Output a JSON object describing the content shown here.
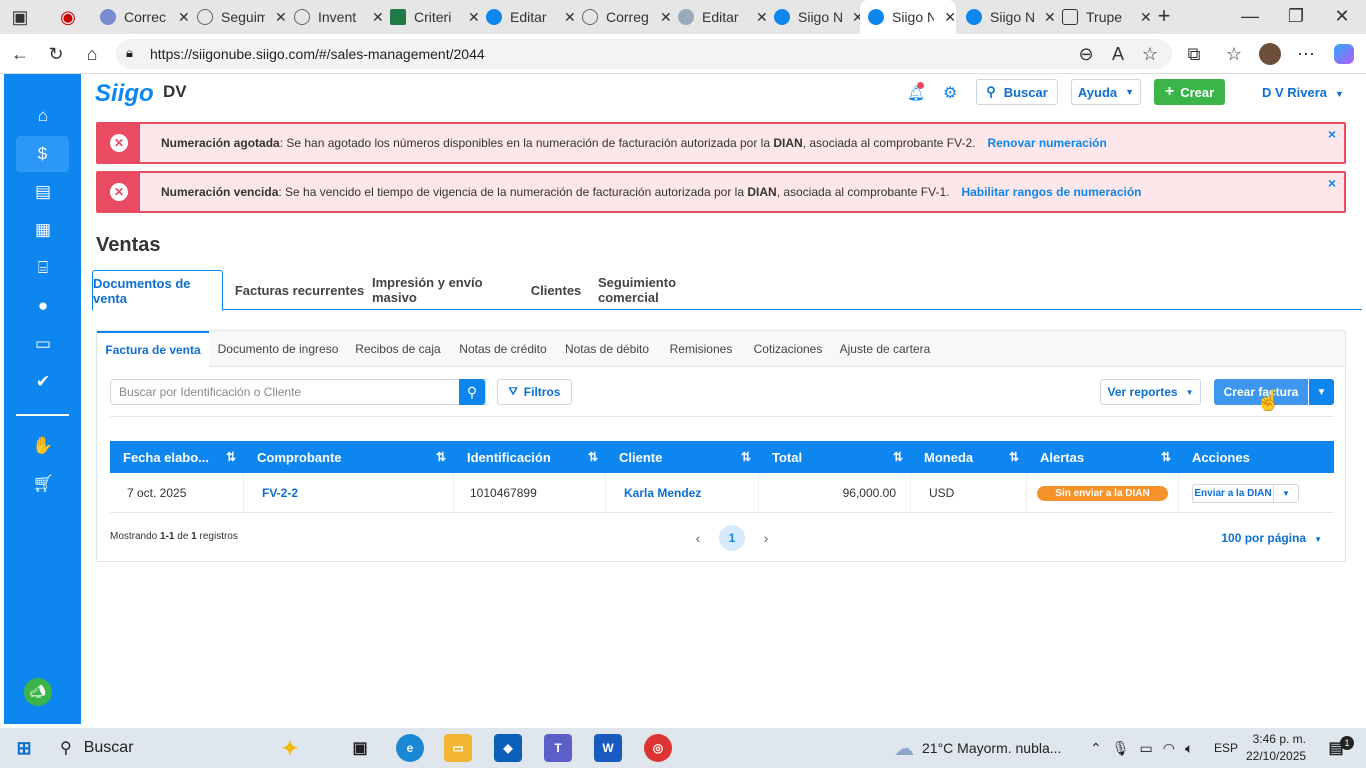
{
  "browser": {
    "tabs": [
      {
        "title": "Correc",
        "color": "#7a8ccf"
      },
      {
        "title": "Seguim",
        "color": "#888888"
      },
      {
        "title": "Invent",
        "color": "#888888"
      },
      {
        "title": "Criteri",
        "color": "#1f7a45"
      },
      {
        "title": "Editar",
        "color": "#0d86f0"
      },
      {
        "title": "Correg",
        "color": "#888888"
      },
      {
        "title": "Editar",
        "color": "#0d86f0"
      },
      {
        "title": "Siigo N",
        "color": "#0d86f0"
      },
      {
        "title": "Siigo N",
        "color": "#0d86f0"
      },
      {
        "title": "Siigo N",
        "color": "#0d86f0"
      },
      {
        "title": "Trupe",
        "color": "#333333"
      }
    ],
    "active_tab_index": 8,
    "url": "https://siigonube.siigo.com/#/sales-management/2044"
  },
  "topbar": {
    "logo": "Siigo",
    "company": "DV",
    "search_label": "Buscar",
    "help_label": "Ayuda",
    "create_label": "Crear",
    "user_label": "D V Rivera"
  },
  "alerts": [
    {
      "title": "Numeración agotada",
      "text": ": Se han agotado los números disponibles en la numeración de facturación autorizada por la ",
      "bold": "DIAN",
      "text2": ", asociada al comprobante FV-2.",
      "link": "Renovar numeración",
      "close": "×"
    },
    {
      "title": "Numeración vencida",
      "text": ": Se ha vencido el tiempo de vigencia de la numeración de facturación autorizada por la ",
      "bold": "DIAN",
      "text2": ", asociada al comprobante FV-1.",
      "link": "Habilitar rangos de numeración",
      "close": "×"
    }
  ],
  "page": {
    "title": "Ventas",
    "main_tabs": [
      "Documentos de venta",
      "Facturas recurrentes",
      "Impresión y envío masivo",
      "Clientes",
      "Seguimiento comercial"
    ],
    "sub_tabs": [
      "Factura de venta",
      "Documento de ingreso",
      "Recibos de caja",
      "Notas de crédito",
      "Notas de débito",
      "Remisiones",
      "Cotizaciones",
      "Ajuste de cartera"
    ],
    "search_placeholder": "Buscar por Identificación o Cliente",
    "filters_label": "Filtros",
    "reports_label": "Ver reportes",
    "create_invoice_label": "Crear factura"
  },
  "table": {
    "headers": [
      "Fecha elabo...",
      "Comprobante",
      "Identificación",
      "Cliente",
      "Total",
      "Moneda",
      "Alertas",
      "Acciones"
    ],
    "rows": [
      {
        "fecha": "7 oct. 2025",
        "comprobante": "FV-2-2",
        "identificacion": "1010467899",
        "cliente": "Karla Mendez",
        "total": "96,000.00",
        "moneda": "USD",
        "alerta": "Sin enviar a la DIAN",
        "accion": "Enviar a la DIAN"
      }
    ],
    "footer_prefix": "Mostrando ",
    "footer_range": "1-1",
    "footer_mid": " de ",
    "footer_count": "1",
    "footer_suffix": " registros",
    "current_page": "1",
    "per_page": "100 por página"
  },
  "taskbar": {
    "search_label": "Buscar",
    "weather": "21°C  Mayorm. nubla...",
    "lang": "ESP",
    "time": "3:46 p. m.",
    "date": "22/10/2025",
    "notif_count": "1"
  }
}
